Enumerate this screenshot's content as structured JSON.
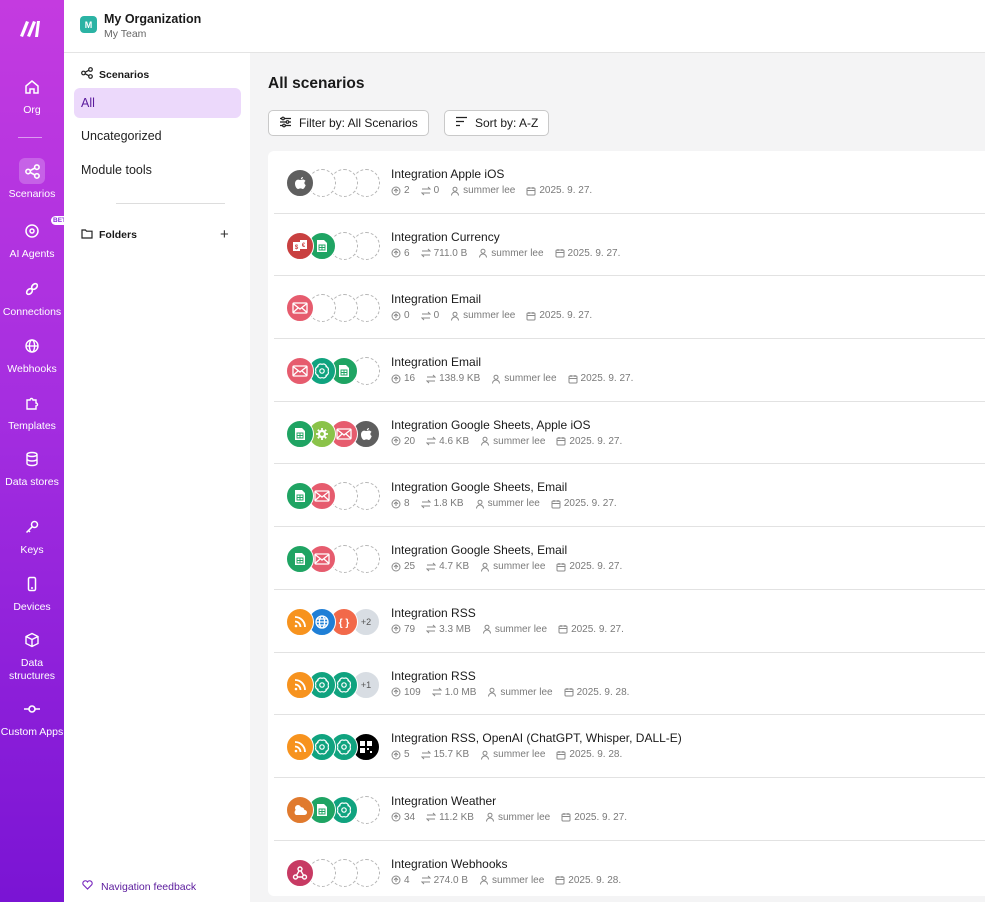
{
  "org": {
    "badge": "M",
    "name": "My Organization",
    "team": "My Team"
  },
  "rail": [
    {
      "id": "org",
      "label": "Org",
      "icon": "home-icon"
    },
    {
      "id": "scenarios",
      "label": "Scenarios",
      "icon": "share-nodes-icon",
      "active": true
    },
    {
      "id": "ai-agents",
      "label": "AI Agents",
      "icon": "ai-agent-icon",
      "badge": "BETA"
    },
    {
      "id": "connections",
      "label": "Connections",
      "icon": "link-icon"
    },
    {
      "id": "webhooks",
      "label": "Webhooks",
      "icon": "globe-icon"
    },
    {
      "id": "templates",
      "label": "Templates",
      "icon": "puzzle-icon"
    },
    {
      "id": "data-stores",
      "label": "Data stores",
      "icon": "database-icon"
    },
    {
      "id": "keys",
      "label": "Keys",
      "icon": "key-icon"
    },
    {
      "id": "devices",
      "label": "Devices",
      "icon": "mobile-icon"
    },
    {
      "id": "data-structures",
      "label": "Data structures",
      "icon": "cube-icon"
    },
    {
      "id": "custom-apps",
      "label": "Custom Apps",
      "icon": "custom-apps-icon"
    }
  ],
  "sidebar": {
    "heading": "Scenarios",
    "items": [
      "All",
      "Uncategorized",
      "Module tools"
    ],
    "folders_label": "Folders",
    "feedback_label": "Navigation feedback"
  },
  "main": {
    "title": "All scenarios",
    "filter_label": "Filter by: All Scenarios",
    "sort_label": "Sort by: A-Z"
  },
  "scenarios": [
    {
      "name": "Integration Apple iOS",
      "ops": "2",
      "transfer": "0",
      "owner": "summer lee",
      "date": "2025. 9. 27.",
      "modules": [
        "apple"
      ]
    },
    {
      "name": "Integration Currency",
      "ops": "6",
      "transfer": "711.0 B",
      "owner": "summer lee",
      "date": "2025. 9. 27.",
      "modules": [
        "currency",
        "sheets"
      ]
    },
    {
      "name": "Integration Email",
      "ops": "0",
      "transfer": "0",
      "owner": "summer lee",
      "date": "2025. 9. 27.",
      "modules": [
        "email"
      ]
    },
    {
      "name": "Integration Email",
      "ops": "16",
      "transfer": "138.9 KB",
      "owner": "summer lee",
      "date": "2025. 9. 27.",
      "modules": [
        "email",
        "openai",
        "sheets"
      ]
    },
    {
      "name": "Integration Google Sheets, Apple iOS",
      "ops": "20",
      "transfer": "4.6 KB",
      "owner": "summer lee",
      "date": "2025. 9. 27.",
      "modules": [
        "sheets",
        "tools",
        "email",
        "apple"
      ]
    },
    {
      "name": "Integration Google Sheets, Email",
      "ops": "8",
      "transfer": "1.8 KB",
      "owner": "summer lee",
      "date": "2025. 9. 27.",
      "modules": [
        "sheets",
        "email"
      ]
    },
    {
      "name": "Integration Google Sheets, Email",
      "ops": "25",
      "transfer": "4.7 KB",
      "owner": "summer lee",
      "date": "2025. 9. 27.",
      "modules": [
        "sheets",
        "email"
      ]
    },
    {
      "name": "Integration RSS",
      "ops": "79",
      "transfer": "3.3 MB",
      "owner": "summer lee",
      "date": "2025. 9. 27.",
      "modules": [
        "rss",
        "http",
        "json"
      ],
      "more": "+2"
    },
    {
      "name": "Integration RSS",
      "ops": "109",
      "transfer": "1.0 MB",
      "owner": "summer lee",
      "date": "2025. 9. 28.",
      "modules": [
        "rss",
        "openai",
        "openai"
      ],
      "more": "+1"
    },
    {
      "name": "Integration RSS, OpenAI (ChatGPT, Whisper, DALL-E)",
      "ops": "5",
      "transfer": "15.7 KB",
      "owner": "summer lee",
      "date": "2025. 9. 28.",
      "modules": [
        "rss",
        "openai",
        "openai",
        "qr"
      ]
    },
    {
      "name": "Integration Weather",
      "ops": "34",
      "transfer": "11.2 KB",
      "owner": "summer lee",
      "date": "2025. 9. 27.",
      "modules": [
        "weather",
        "sheets",
        "openai"
      ]
    },
    {
      "name": "Integration Webhooks",
      "ops": "4",
      "transfer": "274.0 B",
      "owner": "summer lee",
      "date": "2025. 9. 28.",
      "modules": [
        "webhooks"
      ]
    }
  ],
  "module_colors": {
    "apple": "#5f5f5f",
    "sheets": "#1fa463",
    "email": "#e65c6e",
    "openai": "#10a37f",
    "currency": "#c94040",
    "tools": "#8bc34a",
    "rss": "#f7931e",
    "http": "#1f7fd6",
    "json": "#f2694a",
    "qr": "#000000",
    "weather": "#e07a2e",
    "webhooks": "#c73a63"
  }
}
